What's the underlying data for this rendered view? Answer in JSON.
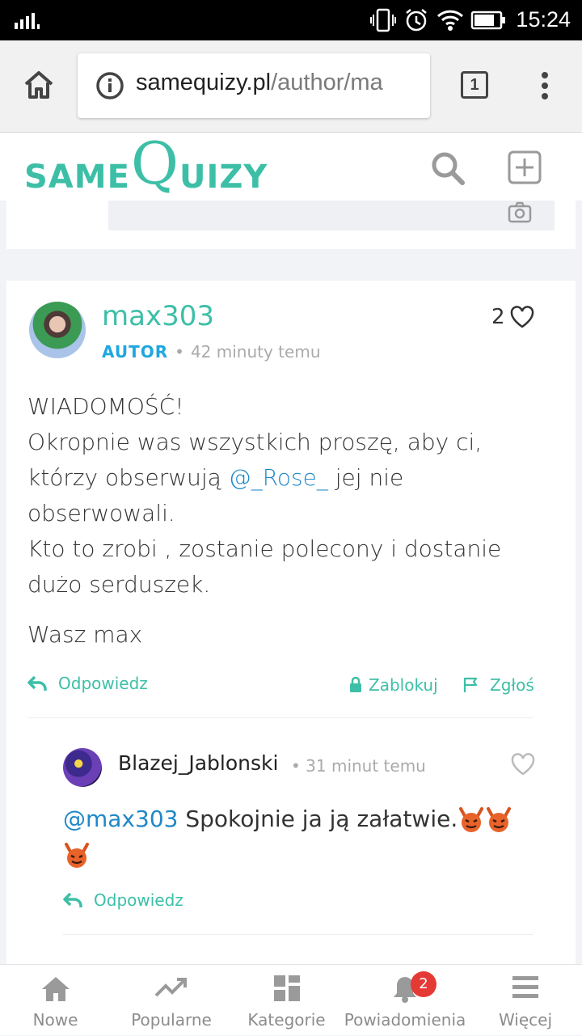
{
  "status_bar": {
    "time": "15:24"
  },
  "browser": {
    "url_domain": "samequizy.pl",
    "url_path": "/author/ma",
    "tab_count": "1"
  },
  "site": {
    "logo_same": "SAME",
    "logo_q": "Q",
    "logo_uizy": "UIZY",
    "accent_color": "#3dbfa7"
  },
  "comment": {
    "author": "max303",
    "badge": "AUTOR",
    "separator": "•",
    "time": "42 minuty temu",
    "likes": "2",
    "lines": {
      "l1": "WIADOMOŚĆ!",
      "l2": "Okropnie was wszystkich proszę, aby ci,",
      "l3_before": "którzy obserwują ",
      "l3_mention": "@_Rose_",
      "l3_after": " jej nie",
      "l4": "obserwowali.",
      "l5": "Kto to zrobi , zostanie polecony i dostanie",
      "l6": "dużo serduszek.",
      "signature": "Wasz max"
    },
    "actions": {
      "reply": "Odpowiedz",
      "block": "Zablokuj",
      "report": "Zgłoś"
    }
  },
  "reply": {
    "author": "Blazej_Jablonski",
    "separator": "•",
    "time": "31 minut temu",
    "mention": "@max303",
    "text": " Spokojnie ja ją załatwie.",
    "reply_label": "Odpowiedz"
  },
  "bottom_nav": {
    "items": [
      {
        "label": "Nowe",
        "icon": "home-icon"
      },
      {
        "label": "Popularne",
        "icon": "trending-icon"
      },
      {
        "label": "Kategorie",
        "icon": "grid-icon"
      },
      {
        "label": "Powiadomienia",
        "icon": "bell-icon",
        "badge": "2"
      },
      {
        "label": "Więcej",
        "icon": "menu-icon"
      }
    ]
  }
}
